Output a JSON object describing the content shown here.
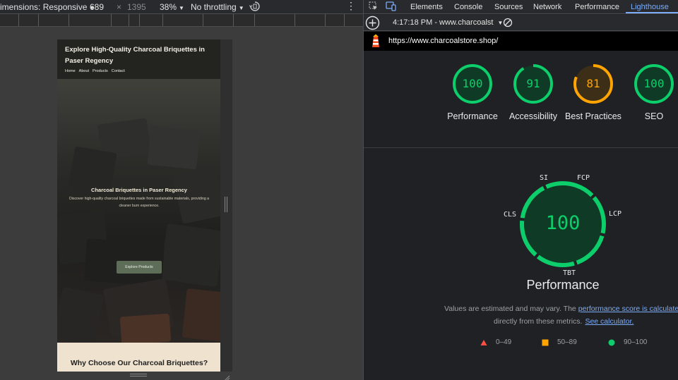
{
  "device_toolbar": {
    "dimensions_label": "imensions: Responsive",
    "width_value": "689",
    "times": "×",
    "height_value": "1395",
    "zoom": "38%",
    "throttling": "No throttling",
    "more": "⋮"
  },
  "site": {
    "title": "Explore High-Quality Charcoal Briquettes in Paser Regency",
    "nav": [
      "Home",
      "About",
      "Products",
      "Contact"
    ],
    "hero_title": "Charcoal Briquettes in Paser Regency",
    "hero_text": "Discover high-quality charcoal briquettes made from sustainable materials, providing a cleaner burn experience.",
    "hero_button": "Explore Products",
    "section_title": "Why Choose Our Charcoal Briquettes?"
  },
  "devtools": {
    "tabs": [
      {
        "label": "Elements"
      },
      {
        "label": "Console"
      },
      {
        "label": "Sources"
      },
      {
        "label": "Network"
      },
      {
        "label": "Performance"
      },
      {
        "label": "Lighthouse"
      }
    ],
    "report_selector": "4:17:18 PM - www.charcoalst",
    "url": "https://www.charcoalstore.shop/"
  },
  "lighthouse": {
    "scores": [
      {
        "label": "Performance",
        "value": "100"
      },
      {
        "label": "Accessibility",
        "value": "91"
      },
      {
        "label": "Best Practices",
        "value": "81"
      },
      {
        "label": "SEO",
        "value": "100"
      }
    ],
    "main_score": "100",
    "metrics": [
      "SI",
      "FCP",
      "LCP",
      "TBT",
      "CLS"
    ],
    "main_title": "Performance",
    "desc_prefix": "Values are estimated and may vary. The ",
    "desc_link": "performance score is calculated",
    "desc_mid": "directly from these metrics.",
    "desc_calc": "See calculator.",
    "legend": [
      {
        "label": "0–49",
        "color": "#ff4e42"
      },
      {
        "label": "50–89",
        "color": "#ffa400"
      },
      {
        "label": "90–100",
        "color": "#0cce6b"
      }
    ]
  },
  "colors": {
    "pass": "#0cce6b",
    "average": "#ffa400",
    "fail": "#ff4e42",
    "accent": "#7cacf8"
  }
}
